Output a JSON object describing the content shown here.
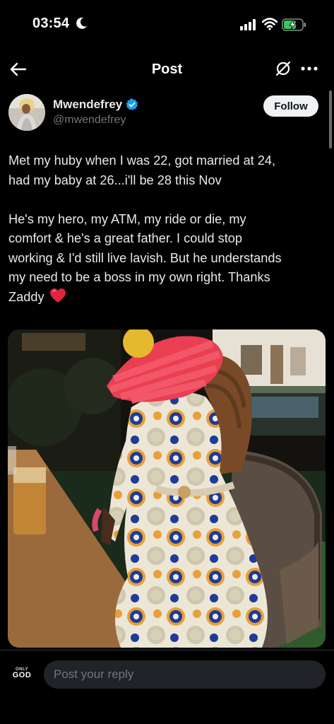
{
  "status_bar": {
    "time": "03:54",
    "icons": [
      "moon-icon",
      "signal-icon",
      "wifi-icon",
      "battery-charging-icon"
    ]
  },
  "nav": {
    "title": "Post",
    "icons": [
      "back-arrow-icon",
      "grok-icon",
      "more-icon"
    ]
  },
  "author": {
    "name": "Mwendefrey",
    "handle": "@mwendefrey",
    "verified": true,
    "verified_color": "#1d9bf0",
    "follow_label": "Follow"
  },
  "post": {
    "paragraph1_line1": "Met my huby when I was 22, got married at 24,",
    "paragraph1_line2": "had my baby at 26...i'll be 28 this Nov",
    "paragraph2_line1": "He's my hero, my ATM, my ride or die, my",
    "paragraph2_line2": "comfort & he's a great father. I could stop",
    "paragraph2_line3": "working & I'd still live lavish. But he understands",
    "paragraph2_line4": "my need to be a boss in my own right. Thanks",
    "paragraph2_line5": "Zaddy",
    "emoji": "red-heart-icon"
  },
  "reply": {
    "avatar_small": "ONLY",
    "avatar_big": "GOD",
    "placeholder": "Post your reply"
  },
  "colors": {
    "background": "#000000",
    "text": "#e7e9ea",
    "secondary_text": "#71767b",
    "verified": "#1d9bf0",
    "input_bg": "#202327"
  }
}
